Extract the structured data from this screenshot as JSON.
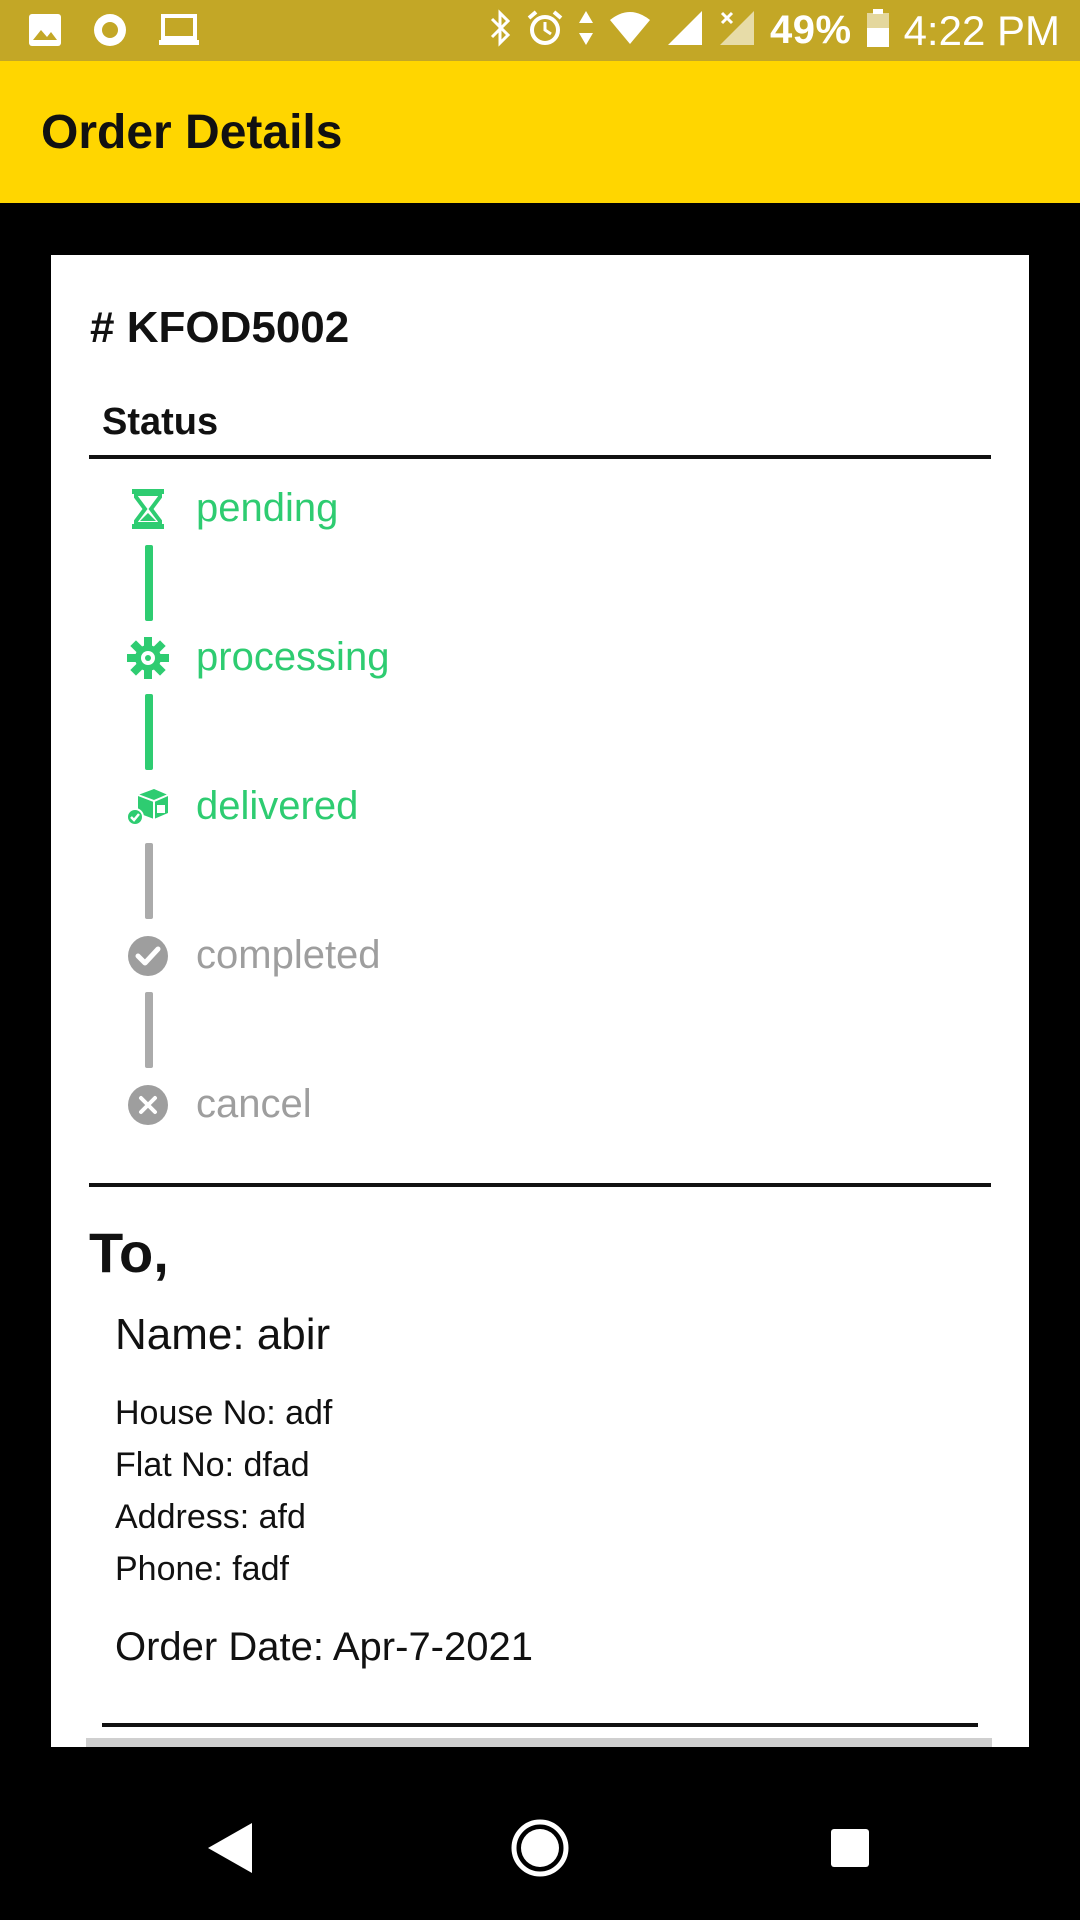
{
  "status_bar": {
    "battery_percent": "49%",
    "time": "4:22 PM",
    "left_icons": [
      "image-icon",
      "record-icon",
      "laptop-icon"
    ],
    "right_icons": [
      "bluetooth-icon",
      "alarm-icon",
      "data-arrows-icon",
      "wifi-icon",
      "signal-icon",
      "signal-x-icon",
      "battery-icon"
    ]
  },
  "app_bar": {
    "title": "Order Details",
    "background": "#FFD600"
  },
  "order": {
    "id_label": "# KFOD5002",
    "status_heading": "Status",
    "steps": [
      {
        "label": "pending",
        "icon": "hourglass-icon",
        "state": "done"
      },
      {
        "label": "processing",
        "icon": "gear-icon",
        "state": "done"
      },
      {
        "label": "delivered",
        "icon": "delivery-box-icon",
        "state": "done"
      },
      {
        "label": "completed",
        "icon": "check-circle-icon",
        "state": "todo"
      },
      {
        "label": "cancel",
        "icon": "x-circle-icon",
        "state": "todo"
      }
    ],
    "colors": {
      "done": "#2ECC71",
      "todo": "#9E9E9E"
    }
  },
  "recipient": {
    "heading": "To,",
    "name": "Name: abir",
    "house": "House No: adf",
    "flat": "Flat No: dfad",
    "address": "Address: afd",
    "phone": "Phone: fadf",
    "order_date": "Order Date: Apr-7-2021"
  },
  "nav_bar": {
    "buttons": [
      "back-icon",
      "home-icon",
      "recents-icon"
    ]
  }
}
